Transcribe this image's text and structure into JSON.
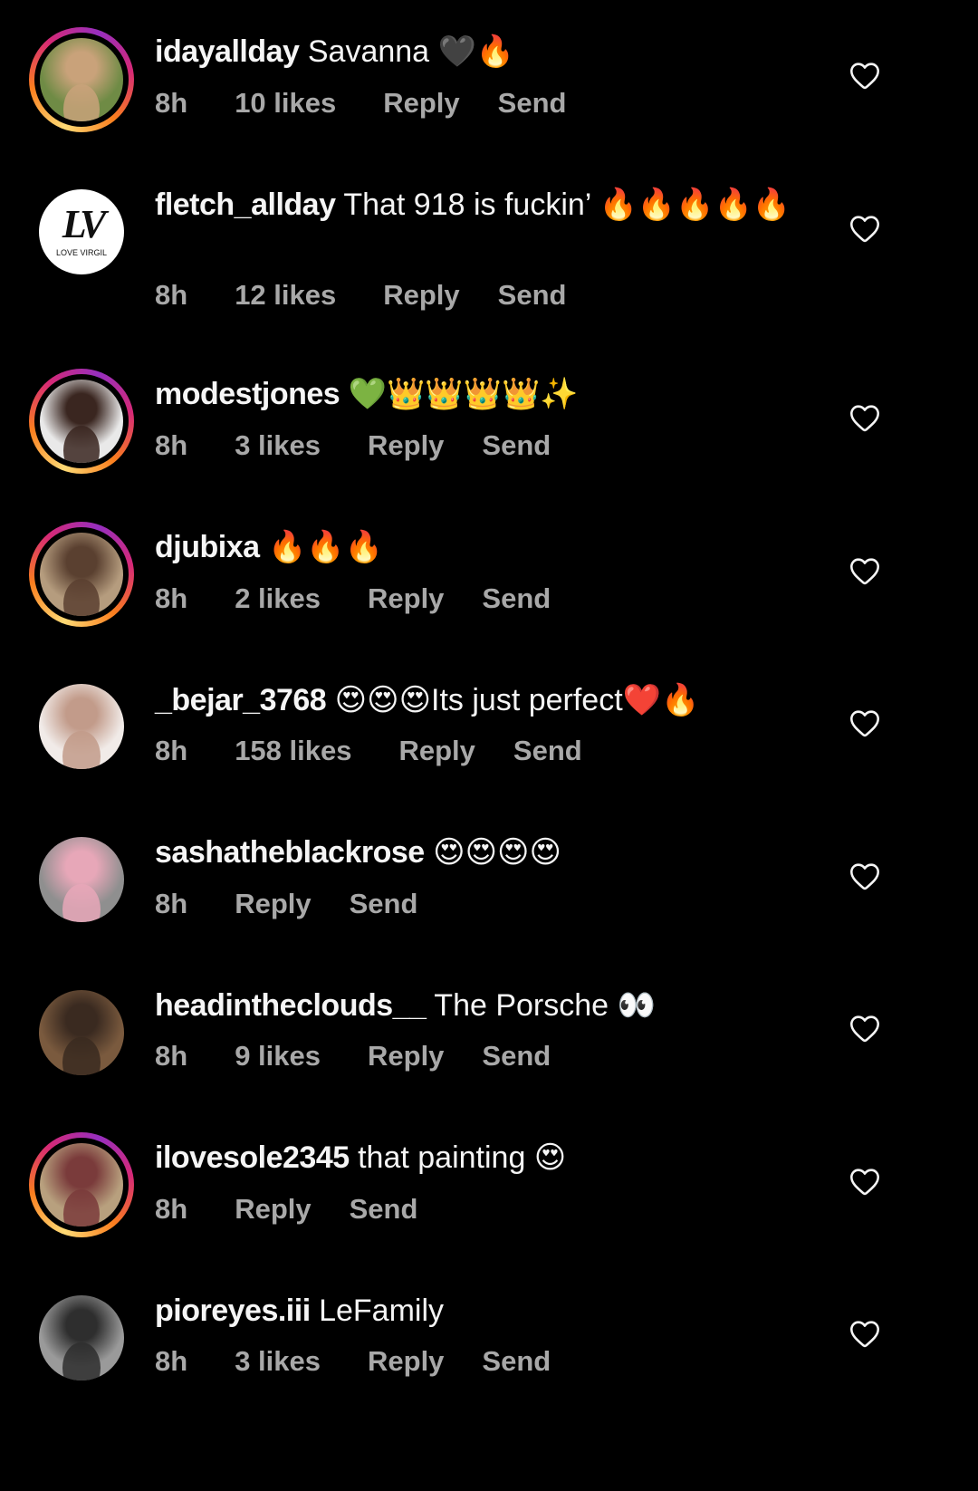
{
  "comments": [
    {
      "username": "idayallday",
      "text": " Savanna 🖤🔥",
      "time": "8h",
      "likes": "10 likes",
      "reply": "Reply",
      "send": "Send",
      "story_ring": true,
      "avatar_colors": [
        "#6f8b45",
        "#c9a27a"
      ]
    },
    {
      "username": "fletch_allday",
      "text": " That 918 is fuckin’ 🔥🔥🔥🔥🔥",
      "time": "8h",
      "likes": "12 likes",
      "reply": "Reply",
      "send": "Send",
      "story_ring": false,
      "avatar_logo": "LV",
      "avatar_logo_sub": "LOVE VIRGIL"
    },
    {
      "username": "modestjones",
      "text": " 💚👑👑👑👑✨",
      "time": "8h",
      "likes": "3 likes",
      "reply": "Reply",
      "send": "Send",
      "story_ring": true,
      "avatar_colors": [
        "#e9e9e9",
        "#3a2620"
      ]
    },
    {
      "username": "djubixa",
      "text": " 🔥🔥🔥",
      "time": "8h",
      "likes": "2 likes",
      "reply": "Reply",
      "send": "Send",
      "story_ring": true,
      "avatar_colors": [
        "#b59c7e",
        "#5a4030"
      ]
    },
    {
      "username": "_bejar_3768",
      "text": " 😍😍😍Its just perfect❤️🔥",
      "time": "8h",
      "likes": "158 likes",
      "reply": "Reply",
      "send": "Send",
      "story_ring": false,
      "avatar_colors": [
        "#f1ebe8",
        "#c29b8a"
      ]
    },
    {
      "username": "sashatheblackrose",
      "text": " 😍😍😍😍",
      "time": "8h",
      "likes": "",
      "reply": "Reply",
      "send": "Send",
      "story_ring": false,
      "avatar_colors": [
        "#8f8f8f",
        "#e7a7b8"
      ]
    },
    {
      "username": "headintheclouds__",
      "text": " The Porsche 👀",
      "time": "8h",
      "likes": "9 likes",
      "reply": "Reply",
      "send": "Send",
      "story_ring": false,
      "avatar_colors": [
        "#7a5a3e",
        "#3a2a20"
      ]
    },
    {
      "username": "ilovesole2345",
      "text": " that painting 😍",
      "time": "8h",
      "likes": "",
      "reply": "Reply",
      "send": "Send",
      "story_ring": true,
      "avatar_colors": [
        "#b8a07e",
        "#7a3b3b"
      ]
    },
    {
      "username": "pioreyes.iii",
      "text": " LeFamily",
      "time": "8h",
      "likes": "3 likes",
      "reply": "Reply",
      "send": "Send",
      "story_ring": false,
      "avatar_colors": [
        "#9a9a9a",
        "#2e2e2e"
      ]
    }
  ],
  "icons": {
    "like": "heart-outline-icon"
  },
  "colors": {
    "background": "#000000",
    "primary_text": "#f5f5f5",
    "secondary_text": "#a8a8a8"
  }
}
